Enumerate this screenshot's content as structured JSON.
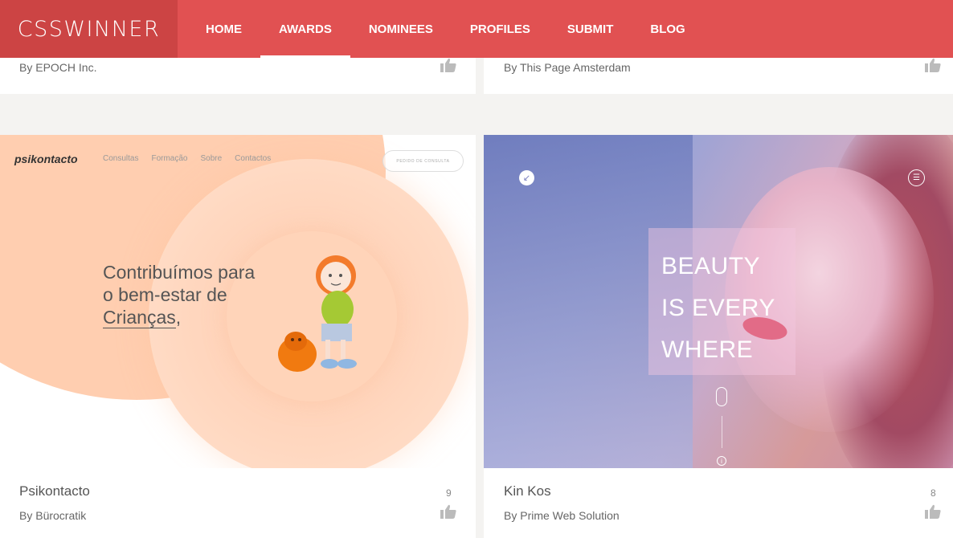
{
  "nav": {
    "logo": "CSSWINNER",
    "items": [
      {
        "label": "HOME",
        "active": false
      },
      {
        "label": "AWARDS",
        "active": true
      },
      {
        "label": "NOMINEES",
        "active": false
      },
      {
        "label": "PROFILES",
        "active": false
      },
      {
        "label": "SUBMIT",
        "active": false
      },
      {
        "label": "BLOG",
        "active": false
      }
    ]
  },
  "cards_top": [
    {
      "by": "By EPOCH Inc.",
      "like_icon": "thumbs-up-icon"
    },
    {
      "by": "By This Page Amsterdam",
      "like_icon": "thumbs-up-icon"
    }
  ],
  "cards_bottom": [
    {
      "title": "Psikontacto",
      "by": "By Bürocratik",
      "likes": "9",
      "like_icon": "thumbs-up-icon",
      "shot": {
        "logo": "psikontacto",
        "nav": [
          "Consultas",
          "Formação",
          "Sobre",
          "Contactos"
        ],
        "button": "PEDIDO DE CONSULTA",
        "headline_1": "Contribuímos para",
        "headline_2": "o bem-estar de",
        "headline_3": "Crianças",
        "headline_3_suffix": ","
      }
    },
    {
      "title": "Kin Kos",
      "by": "By Prime Web Solution",
      "likes": "8",
      "like_icon": "thumbs-up-icon",
      "shot": {
        "line_1": "BEAUTY",
        "line_2": "IS EVERY",
        "line_3": "WHERE"
      }
    }
  ],
  "colors": {
    "nav_bg": "#e15152",
    "logo_bg": "#cc4444",
    "page_bg": "#f4f3f1",
    "peach": "#ffceb0"
  }
}
